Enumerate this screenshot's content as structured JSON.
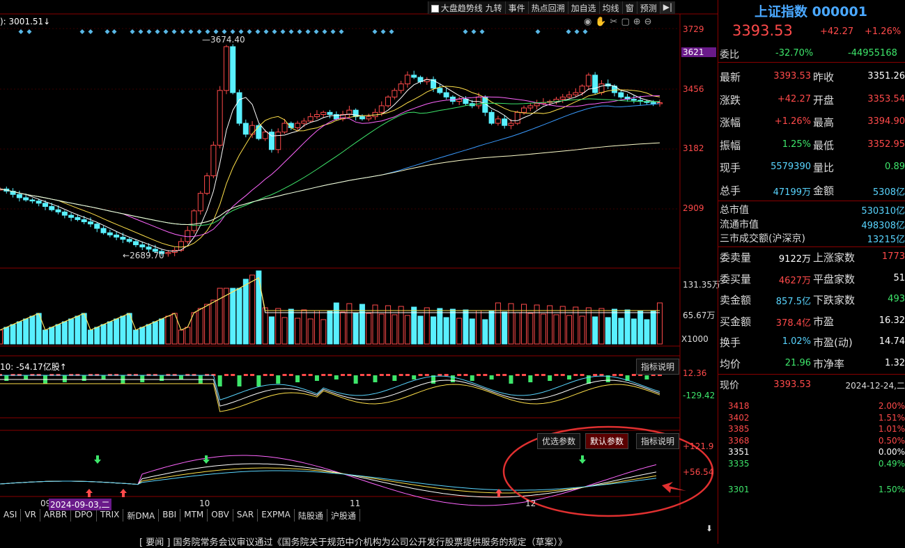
{
  "toolbar": {
    "items": [
      "大盘趋势线 九转",
      "事件",
      "热点回溯",
      "加自选",
      "均线",
      "窗",
      "预测"
    ],
    "play_icon": "play-icon"
  },
  "main_chart": {
    "top_left_label": "): 3001.51↓",
    "price_axis": [
      "3729",
      "3621",
      "3456",
      "3182",
      "2909"
    ],
    "high_annotation": "3674.40",
    "low_annotation": "2689.70",
    "tool_icons": [
      "eye-icon",
      "hand-icon",
      "scissors-icon",
      "lock-icon",
      "zoom-in-icon",
      "zoom-out-icon"
    ]
  },
  "volume_panel": {
    "axis": [
      "131.35万",
      "65.67万",
      "X1000"
    ]
  },
  "fund_panel": {
    "label": "10: -54.17亿股↑",
    "axis": [
      "12.36",
      "-129.42"
    ],
    "button": "指标说明"
  },
  "osc_panel": {
    "axis": [
      "+121.9",
      "+56.54"
    ],
    "buttons": [
      "优选参数",
      "默认参数",
      "指标说明"
    ],
    "date_labels": [
      "09",
      "2024-09-03,二",
      "10",
      "11",
      "12"
    ]
  },
  "tabs": [
    "ASI",
    "VR",
    "ARBR",
    "DPO",
    "TRIX",
    "新DMA",
    "BBI",
    "MTM",
    "OBV",
    "SAR",
    "EXPMA",
    "陆股通",
    "沪股通"
  ],
  "ticker_text": "[ 要闻 ] 国务院常务会议审议通过《国务院关于规范中介机构为公司公开发行股票提供服务的规定（草案）》",
  "right_panel": {
    "title": "上证指数 000001",
    "price": "3393.53",
    "change": "+42.27",
    "change_pct": "+1.26%",
    "weibi": {
      "label": "委比",
      "pct": "-32.70%",
      "value": "-44955168"
    },
    "stats": [
      {
        "l1": "最新",
        "v1": "3393.53",
        "l2": "昨收",
        "v2": "3351.26"
      },
      {
        "l1": "涨跌",
        "v1": "+42.27",
        "l2": "开盘",
        "v2": "3353.54"
      },
      {
        "l1": "涨幅",
        "v1": "+1.26%",
        "l2": "最高",
        "v2": "3394.90"
      },
      {
        "l1": "振幅",
        "v1": "1.25%",
        "l2": "最低",
        "v2": "3352.95"
      },
      {
        "l1": "现手",
        "v1": "5579390",
        "l2": "量比",
        "v2": "0.89"
      },
      {
        "l1": "总手",
        "v1": "47199万",
        "l2": "金额",
        "v2": "5308亿"
      }
    ],
    "market": [
      {
        "l": "总市值",
        "v": "530310亿"
      },
      {
        "l": "流通市值",
        "v": "498308亿"
      },
      {
        "l": "三市成交额(沪深京)",
        "v": "13215亿"
      }
    ],
    "orders": [
      {
        "l1": "委卖量",
        "v1": "9122万",
        "l2": "上涨家数",
        "v2": "1773"
      },
      {
        "l1": "委买量",
        "v1": "4627万",
        "l2": "平盘家数",
        "v2": "51"
      },
      {
        "l1": "卖金额",
        "v1": "857.5亿",
        "l2": "下跌家数",
        "v2": "493"
      },
      {
        "l1": "买金额",
        "v1": "378.4亿",
        "l2": "市盈",
        "v2": "16.32"
      },
      {
        "l1": "换手",
        "v1": "1.02%",
        "l2": "市盈(动)",
        "v2": "14.74"
      },
      {
        "l1": "均价",
        "v1": "21.96",
        "l2": "市净率",
        "v2": "1.32"
      }
    ],
    "intraday": {
      "label": "现价",
      "price": "3393.53",
      "date": "2024-12-24,二",
      "left_axis": [
        "3418",
        "3402",
        "3385",
        "3368",
        "3351",
        "3335",
        "3301"
      ],
      "right_axis": [
        "2.00%",
        "1.51%",
        "1.01%",
        "0.50%",
        "0.00%",
        "0.49%",
        "1.50%"
      ]
    }
  },
  "colors": {
    "up": "#ff4a4a",
    "down": "#59f0ff",
    "border": "#8a0000",
    "annotation": "#e03030"
  }
}
